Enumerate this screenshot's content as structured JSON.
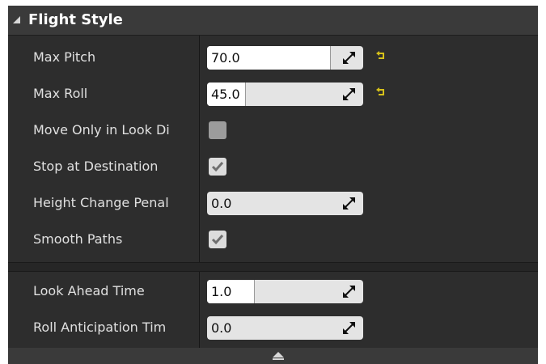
{
  "section": {
    "title": "Flight Style"
  },
  "rows": [
    {
      "label": "Max Pitch",
      "type": "number",
      "value": "70.0",
      "fill_fraction": 0.81,
      "has_reset": true
    },
    {
      "label": "Max Roll",
      "type": "number",
      "value": "45.0",
      "fill_fraction": 0.25,
      "has_reset": true
    },
    {
      "label": "Move Only in Look Di",
      "type": "checkbox",
      "checked": false
    },
    {
      "label": "Stop at Destination",
      "type": "checkbox",
      "checked": true
    },
    {
      "label": "Height Change Penal",
      "type": "number",
      "value": "0.0",
      "fill_fraction": 0,
      "has_reset": false
    },
    {
      "label": "Smooth Paths",
      "type": "checkbox",
      "checked": true
    }
  ],
  "advanced_rows": [
    {
      "label": "Look Ahead Time",
      "type": "number",
      "value": "1.0",
      "fill_fraction": 0.31,
      "has_reset": false
    },
    {
      "label": "Roll Anticipation Tim",
      "type": "number",
      "value": "0.0",
      "fill_fraction": 0,
      "has_reset": false
    }
  ],
  "icons": {
    "collapse": "triangle-down-icon",
    "resize": "resize-arrows-icon",
    "reset": "reset-to-default-icon",
    "check": "checkmark-icon",
    "expand": "advanced-expand-icon"
  },
  "colors": {
    "panel_bg": "#2d2d2d",
    "header_bg": "#3a3a3a",
    "reset_yellow": "#d6c11a"
  }
}
